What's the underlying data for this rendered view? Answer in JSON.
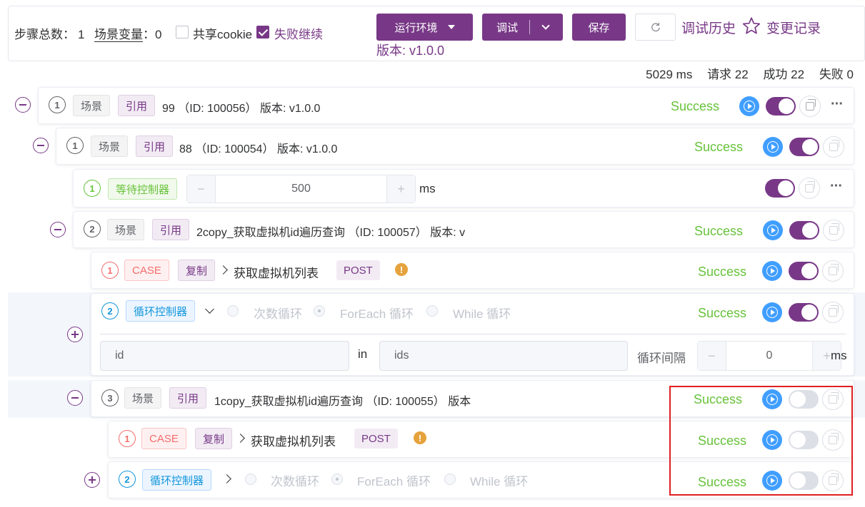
{
  "top": {
    "steps_label": "步骤总数：",
    "steps_value": "1",
    "vars_label": "场景变量",
    "vars_colon": "：",
    "vars_value": "0",
    "share_cookie": "共享cookie",
    "continue_on_fail": "失败继续",
    "env_button": "运行环境",
    "debug_button": "调试",
    "save_button": "保存",
    "debug_history": "调试历史",
    "change_log": "变更记录",
    "version": "版本: v1.0.0"
  },
  "stats": {
    "duration": "5029 ms",
    "requests": "请求 22",
    "success": "成功 22",
    "failed": "失败 0"
  },
  "rows": [
    {
      "num": "1",
      "tag1": "场景",
      "tag2": "引用",
      "text": "99 （ID: 100056） 版本: v1.0.0",
      "status": "Success"
    },
    {
      "num": "1",
      "tag1": "场景",
      "tag2": "引用",
      "text": "88 （ID: 100054） 版本: v1.0.0",
      "status": "Success"
    },
    {
      "num": "1",
      "tag1": "等待控制器",
      "wait_value": "500",
      "unit": "ms"
    },
    {
      "num": "2",
      "tag1": "场景",
      "tag2": "引用",
      "text": "2copy_获取虚拟机id遍历查询 （ID: 100057） 版本: v",
      "status": "Success"
    },
    {
      "num": "1",
      "tag1": "CASE",
      "tag2": "复制",
      "text": "获取虚拟机列表",
      "method": "POST",
      "status": "Success"
    },
    {
      "num": "2",
      "tag1": "循环控制器",
      "opt1": "次数循环",
      "opt2": "ForEach 循环",
      "opt3": "While 循环",
      "status": "Success",
      "var_value": "id",
      "in_label": "in",
      "list_value": "ids",
      "interval_label": "循环间隔",
      "interval_value": "0",
      "unit": "ms"
    },
    {
      "num": "3",
      "tag1": "场景",
      "tag2": "引用",
      "text": "1copy_获取虚拟机id遍历查询 （ID: 100055） 版本",
      "status": "Success"
    },
    {
      "num": "1",
      "tag1": "CASE",
      "tag2": "复制",
      "text": "获取虚拟机列表",
      "method": "POST",
      "status": "Success"
    },
    {
      "num": "2",
      "tag1": "循环控制器",
      "opt1": "次数循环",
      "opt2": "ForEach 循环",
      "opt3": "While 循环",
      "status": "Success"
    }
  ],
  "icons": {
    "minus": "collapse-icon",
    "plus": "expand-icon",
    "play": "play-icon",
    "copy": "copy-icon",
    "more": "more-icon",
    "star": "star-icon",
    "refresh": "refresh-icon",
    "warning": "warning-icon"
  },
  "colors": {
    "brand": "#783887",
    "success": "#67c23a",
    "play": "#409eff",
    "highlight": "#e02020"
  }
}
